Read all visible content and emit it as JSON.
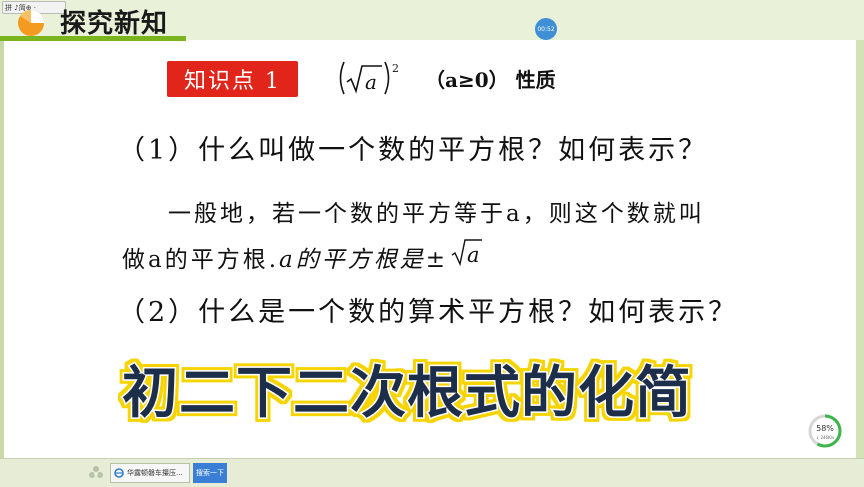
{
  "header": {
    "section_title": "探究新知",
    "ime_label": "拼 ♪简⊕ ·",
    "timer": "00:52"
  },
  "knowledge_point": {
    "badge": "知识点 1",
    "formula_var": "a",
    "formula_exp": "2",
    "condition_open": "（a≥0）",
    "condition_text": "性质"
  },
  "content": {
    "q1": "（1）什么叫做一个数的平方根？如何表示？",
    "def_line1": "一般地，若一个数的平方等于a，则这个数就叫",
    "def_line2_prefix": "做a的平方根.",
    "def_line2_italic": "a的平方根是",
    "def_pm": "±",
    "def_root_var": "a",
    "q2": "（2）什么是一个数的算术平方根？如何表示？"
  },
  "overlay_caption": "初二下二次根式的化简",
  "speed_widget": {
    "percent": "58%",
    "rate": "↓ 246K/s"
  },
  "taskbar": {
    "browser_label": "华露顿磐车攥压...",
    "search_label": "搜索一下"
  },
  "colors": {
    "badge_red": "#e1251b",
    "accent_green": "#7ab51d",
    "overlay_fill": "#1f2e4a",
    "overlay_glow": "#f5d400"
  }
}
